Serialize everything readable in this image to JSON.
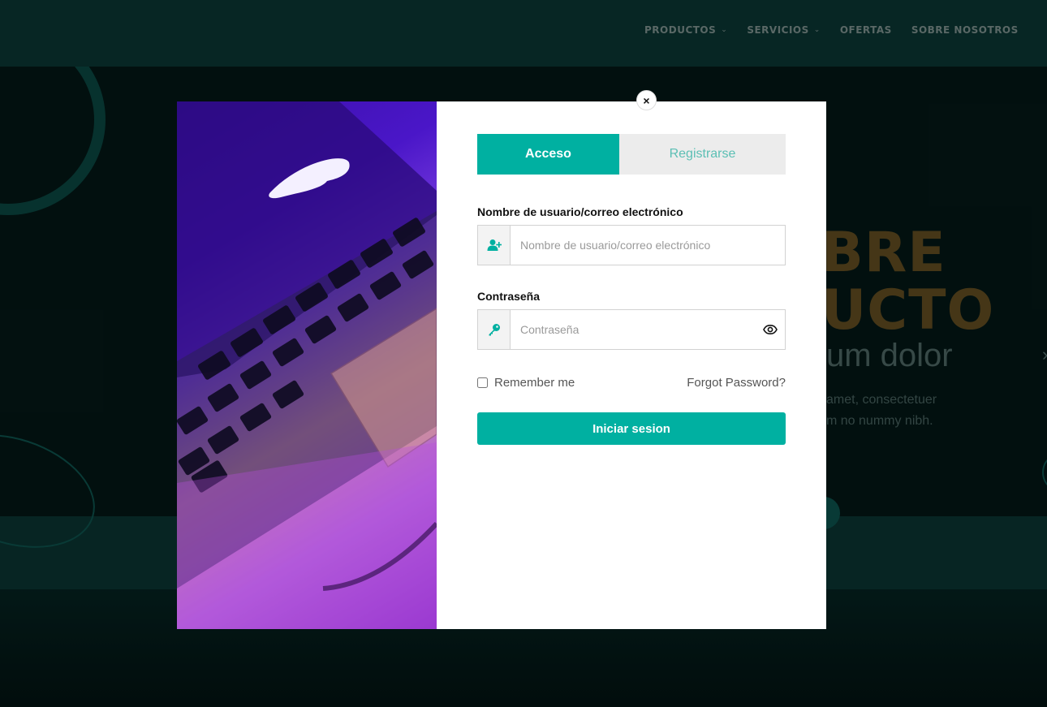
{
  "nav": {
    "items": [
      {
        "label": "PRODUCTOS",
        "has_dropdown": true
      },
      {
        "label": "SERVICIOS",
        "has_dropdown": true
      },
      {
        "label": "OFERTAS",
        "has_dropdown": false
      },
      {
        "label": "SOBRE NOSOTROS",
        "has_dropdown": false
      }
    ],
    "chevron": "⌄"
  },
  "hero": {
    "line1": "BRE",
    "line2": "UCTO",
    "line3": "um dolor",
    "para1": "amet, consectetuer",
    "para2": "m no nummy nibh."
  },
  "modal": {
    "close_label": "×",
    "tabs": {
      "login": "Acceso",
      "register": "Registrarse"
    },
    "username": {
      "label": "Nombre de usuario/correo electrónico",
      "placeholder": "Nombre de usuario/correo electrónico",
      "value": ""
    },
    "password": {
      "label": "Contraseña",
      "placeholder": "Contraseña",
      "value": ""
    },
    "remember_label": "Remember me",
    "remember_checked": false,
    "forgot_label": "Forgot Password?",
    "submit_label": "Iniciar sesion"
  },
  "colors": {
    "accent": "#00b0a1",
    "tab_inactive_bg": "#ececec",
    "header_bg": "#0b3b38"
  },
  "icons": {
    "username": "user-plus-icon",
    "password": "key-icon",
    "reveal": "eye-icon",
    "close": "close-icon"
  }
}
